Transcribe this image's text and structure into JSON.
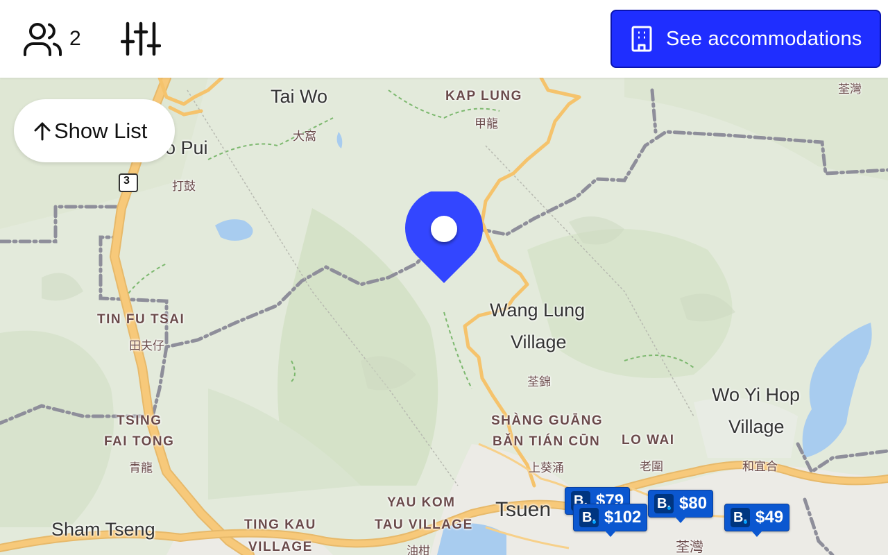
{
  "topbar": {
    "guest_count": "2",
    "guests_icon": "users-icon",
    "filter_icon": "sliders-icon",
    "cta_icon": "building-icon",
    "cta_label": "See accommodations",
    "accent_color": "#1f2eff"
  },
  "show_list": {
    "label": "Show List",
    "icon": "arrow-up-icon"
  },
  "map": {
    "place_labels": {
      "tai_wo": "Tai Wo",
      "o_pui": "o Pui",
      "wang_lung_1": "Wang Lung",
      "wang_lung_2": "Village",
      "wo_yi_hop_1": "Wo Yi Hop",
      "wo_yi_hop_2": "Village",
      "sham_tseng": "Sham Tseng",
      "tsuen": "Tsuen"
    },
    "district_labels": {
      "kap_lung": "KAP LUNG",
      "tin_fu_tsai": "TIN FU TSAI",
      "tsing_1": "TSING",
      "tsing_2": "FAI TONG",
      "shang_guang": "SHÀNG GUĀNG",
      "ban_tian_cun": "BǍN TIÁN CŪN",
      "lo_wai": "LO WAI",
      "yau_kom_1": "YAU KOM",
      "yau_kom_2": "TAU VILLAGE",
      "ting_kau_1": "TING KAU",
      "ting_kau_2": "VILLAGE"
    },
    "cjk_labels": {
      "a": "大窩",
      "b": "打鼓",
      "c": "甲龍",
      "d": "荃錦",
      "e": "田夫仔",
      "f": "青龍",
      "g": "老圍",
      "h": "上葵涌",
      "i": "和宜合",
      "j": "荃灣",
      "k": "荃灣",
      "l": "油柑"
    },
    "route_shield": "3",
    "pin_icon": "map-pin-icon",
    "pin_color": "#3346ff"
  },
  "price_badges": [
    {
      "price": "$79",
      "logo": "B."
    },
    {
      "price": "$80",
      "logo": "B."
    },
    {
      "price": "$102",
      "logo": "B."
    },
    {
      "price": "$49",
      "logo": "B."
    }
  ]
}
